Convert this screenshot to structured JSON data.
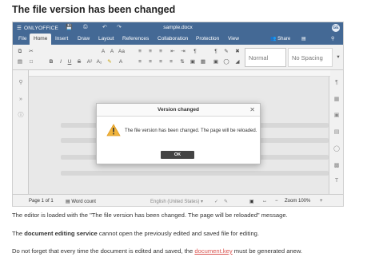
{
  "page_title": "The file version has been changed",
  "app": {
    "brand": "ONLYOFFICE",
    "doc_title": "sample.docx",
    "avatar_initials": "GE",
    "tabs": [
      {
        "label": "File"
      },
      {
        "label": "Home"
      },
      {
        "label": "Insert"
      },
      {
        "label": "Draw"
      },
      {
        "label": "Layout"
      },
      {
        "label": "References"
      },
      {
        "label": "Collaboration"
      },
      {
        "label": "Protection"
      },
      {
        "label": "View"
      }
    ],
    "share_label": "Share",
    "styles": [
      "Normal",
      "No Spacing"
    ],
    "status": {
      "page": "Page 1 of 1",
      "word_count": "Word count",
      "language": "English (United States)",
      "zoom": "Zoom 100%"
    },
    "accent_color": "#446995"
  },
  "dialog": {
    "title": "Version changed",
    "message": "The file version has been changed. The page will be reloaded.",
    "ok_label": "OK",
    "warning_color": "#f0b43c"
  },
  "paragraphs": {
    "p1": "The editor is loaded with the \"The file version has been changed. The page will be reloaded\" message.",
    "p2_pre": "The ",
    "p2_bold": "document editing service",
    "p2_post": " cannot open the previously edited and saved file for editing.",
    "p3_pre": "Do not forget that every time the document is edited and saved, the ",
    "p3_link": "document.key",
    "p3_post": " must be generated anew."
  }
}
